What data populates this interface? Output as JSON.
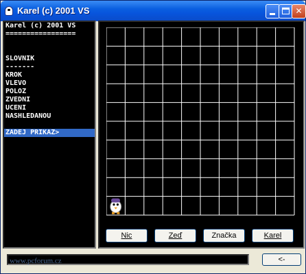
{
  "window": {
    "title": "Karel (c) 2001 VS"
  },
  "console": {
    "lines": [
      {
        "text": "Karel (c) 2001 VS",
        "highlight": false
      },
      {
        "text": "=================",
        "highlight": false
      },
      {
        "text": "",
        "highlight": false
      },
      {
        "text": "",
        "highlight": false
      },
      {
        "text": "SLOVNIK",
        "highlight": false
      },
      {
        "text": "-------",
        "highlight": false
      },
      {
        "text": "KROK",
        "highlight": false
      },
      {
        "text": "VLEVO",
        "highlight": false
      },
      {
        "text": "POLOZ",
        "highlight": false
      },
      {
        "text": "ZVEDNI",
        "highlight": false
      },
      {
        "text": "UCENI",
        "highlight": false
      },
      {
        "text": "NASHLEDANOU",
        "highlight": false
      },
      {
        "text": "",
        "highlight": false
      },
      {
        "text": "ZADEJ PRIKAZ>",
        "highlight": true
      }
    ]
  },
  "world": {
    "columns": 10,
    "rows": 10,
    "karel_col": 0,
    "karel_row": 9,
    "grid_color": "#ffffff",
    "background_color": "#000000"
  },
  "buttons": {
    "nothing": "Nic",
    "wall": "Zeď",
    "mark": "Značka",
    "karel": "Karel"
  },
  "status": {
    "watermark": "www.pcforum.cz",
    "back_label": "<-"
  },
  "colors": {
    "highlight": "#3169c6",
    "titlebar": "#0a5fe0"
  }
}
